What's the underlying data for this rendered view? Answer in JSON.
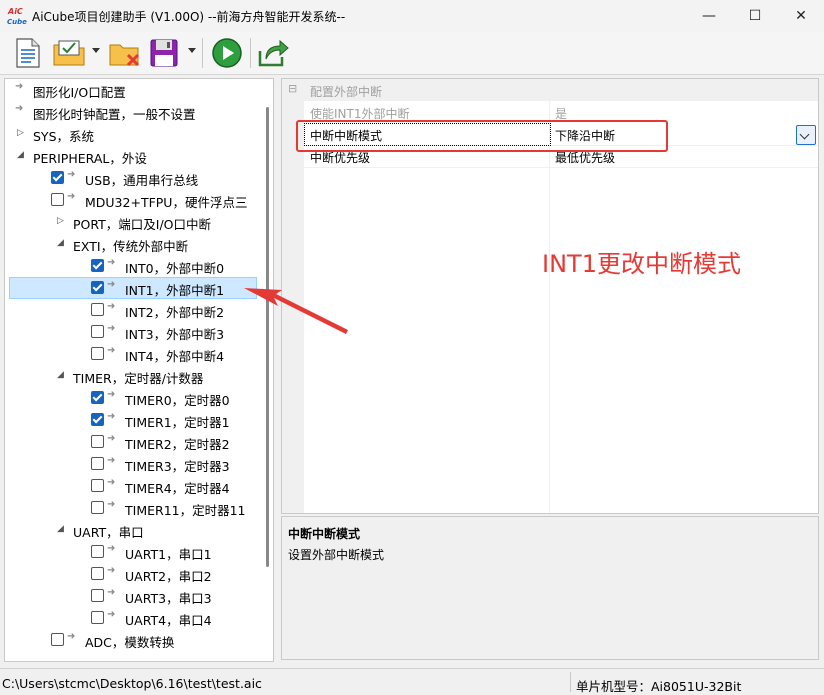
{
  "window": {
    "title": "AiCube项目创建助手 (V1.00O) --前海方舟智能开发系统--",
    "logo_text": [
      "AiC",
      "Cube"
    ],
    "minimize": "—",
    "maximize": "☐",
    "close": "✕"
  },
  "toolbar": {
    "items": [
      {
        "name": "new-document-icon"
      },
      {
        "name": "open-config-icon"
      },
      {
        "name": "close-folder-icon"
      },
      {
        "name": "save-disk-icon"
      },
      {
        "name": "run-play-icon"
      },
      {
        "name": "export-share-icon"
      }
    ]
  },
  "tree": {
    "items": [
      {
        "label": "图形化I/O口配置",
        "indent": 0,
        "pin": true
      },
      {
        "label": "图形化时钟配置，一般不设置",
        "indent": 0,
        "pin": true
      },
      {
        "label": "SYS，系统",
        "indent": 0,
        "expander": "collapsed"
      },
      {
        "label": "PERIPHERAL，外设",
        "indent": 0,
        "expander": "expanded"
      },
      {
        "label": "USB，通用串行总线",
        "indent": 1,
        "check": true,
        "pin": true
      },
      {
        "label": "MDU32+TFPU，硬件浮点三",
        "indent": 1,
        "check": false,
        "pin": true
      },
      {
        "label": "PORT，端口及I/O口中断",
        "indent": 1,
        "expander": "collapsed"
      },
      {
        "label": "EXTI，传统外部中断",
        "indent": 1,
        "expander": "expanded"
      },
      {
        "label": "INT0，外部中断0",
        "indent": 2,
        "check": true,
        "pin": true
      },
      {
        "label": "INT1，外部中断1",
        "indent": 2,
        "check": true,
        "pin": true,
        "selected": true
      },
      {
        "label": "INT2，外部中断2",
        "indent": 2,
        "check": false,
        "pin": true
      },
      {
        "label": "INT3，外部中断3",
        "indent": 2,
        "check": false,
        "pin": true
      },
      {
        "label": "INT4，外部中断4",
        "indent": 2,
        "check": false,
        "pin": true
      },
      {
        "label": "TIMER，定时器/计数器",
        "indent": 1,
        "expander": "expanded"
      },
      {
        "label": "TIMER0，定时器0",
        "indent": 2,
        "check": true,
        "pin": true
      },
      {
        "label": "TIMER1，定时器1",
        "indent": 2,
        "check": true,
        "pin": true
      },
      {
        "label": "TIMER2，定时器2",
        "indent": 2,
        "check": false,
        "pin": true
      },
      {
        "label": "TIMER3，定时器3",
        "indent": 2,
        "check": false,
        "pin": true
      },
      {
        "label": "TIMER4，定时器4",
        "indent": 2,
        "check": false,
        "pin": true
      },
      {
        "label": "TIMER11，定时器11",
        "indent": 2,
        "check": false,
        "pin": true
      },
      {
        "label": "UART，串口",
        "indent": 1,
        "expander": "expanded"
      },
      {
        "label": "UART1，串口1",
        "indent": 2,
        "check": false,
        "pin": true
      },
      {
        "label": "UART2，串口2",
        "indent": 2,
        "check": false,
        "pin": true
      },
      {
        "label": "UART3，串口3",
        "indent": 2,
        "check": false,
        "pin": true
      },
      {
        "label": "UART4，串口4",
        "indent": 2,
        "check": false,
        "pin": true
      },
      {
        "label": "ADC，模数转换",
        "indent": 1,
        "check": false,
        "pin": true
      }
    ]
  },
  "properties": {
    "category": "配置外部中断",
    "category_toggle": "⊟",
    "rows": [
      {
        "name": "使能INT1外部中断",
        "value": "是",
        "disabled": true
      },
      {
        "name": "中断中断模式",
        "value": "下降沿中断",
        "selected": true
      },
      {
        "name": "中断优先级",
        "value": "最低优先级"
      }
    ]
  },
  "description": {
    "title": "中断中断模式",
    "text": "设置外部中断模式"
  },
  "annotation": {
    "text": "INT1更改中断模式",
    "color": "#e53935"
  },
  "status": {
    "path": "C:\\Users\\stcmc\\Desktop\\6.16\\test\\test.aic",
    "mcu": "单片机型号：Ai8051U-32Bit"
  }
}
